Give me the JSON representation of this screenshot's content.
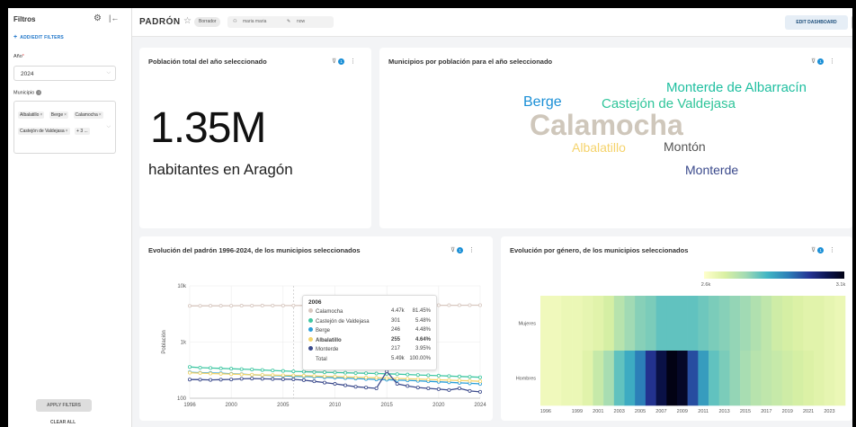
{
  "sidebar": {
    "title": "Filtros",
    "gear_icon": "gear-icon",
    "collapse_icon": "collapse-left-icon",
    "add_filters": "ADD/EDIT FILTERS",
    "year_label": "Año",
    "year_value": "2024",
    "municipio_label": "Municipio",
    "municipio_tags": [
      "Albalatillo",
      "Berge",
      "Calamocha",
      "Castejón de Valdejasa"
    ],
    "municipio_more": "+ 3 ...",
    "apply_label": "APPLY FILTERS",
    "clear_label": "CLEAR ALL"
  },
  "header": {
    "title": "PADRÓN",
    "badge": "Borrador",
    "owner": "maria maria",
    "modified": "now",
    "edit_label": "EDIT DASHBOARD",
    "more_label": "···"
  },
  "cards": {
    "total": {
      "title": "Población total del año seleccionado",
      "filter_count": "1",
      "value": "1.35M",
      "subtitle": "habitantes en Aragón"
    },
    "wordcloud": {
      "title": "Municipios por población para el año seleccionado",
      "filter_count": "1",
      "words": [
        {
          "text": "Monterde de Albarracín",
          "color": "#1fbfa0"
        },
        {
          "text": "Berge",
          "color": "#1a8fd6"
        },
        {
          "text": "Castejón de Valdejasa",
          "color": "#2fc59a"
        },
        {
          "text": "Calamocha",
          "color": "#cfc7bb"
        },
        {
          "text": "Albalatillo",
          "color": "#f5d36b"
        },
        {
          "text": "Montón",
          "color": "#555555"
        },
        {
          "text": "Monterde",
          "color": "#3b4a8c"
        }
      ]
    },
    "evolucion": {
      "title": "Evolución del padrón 1996-2024, de los municipios seleccionados",
      "filter_count": "1",
      "tooltip": {
        "year": "2006",
        "rows": [
          {
            "name": "Calamocha",
            "value": "4.47k",
            "pct": "81.45%",
            "color": "#d8c8c0",
            "bold": false
          },
          {
            "name": "Castejón de Valdejasa",
            "value": "301",
            "pct": "5.48%",
            "color": "#3fc7a2",
            "bold": false
          },
          {
            "name": "Berge",
            "value": "246",
            "pct": "4.48%",
            "color": "#2a9ed8",
            "bold": false
          },
          {
            "name": "Albalatillo",
            "value": "255",
            "pct": "4.64%",
            "color": "#f3d46a",
            "bold": true
          },
          {
            "name": "Monterde",
            "value": "217",
            "pct": "3.95%",
            "color": "#3b4a8c",
            "bold": false
          },
          {
            "name": "Total",
            "value": "5.49k",
            "pct": "100.00%",
            "color": "",
            "bold": false
          }
        ]
      }
    },
    "genero": {
      "title": "Evolución por género, de los municipios seleccionados",
      "filter_count": "1",
      "scale_min": "2.6k",
      "scale_max": "3.1k"
    }
  },
  "colors": {
    "accent": "#1a73c8",
    "filter_badge": "#1a8fd6"
  },
  "chart_data": [
    {
      "type": "line",
      "title": "Evolución del padrón 1996-2024, de los municipios seleccionados",
      "ylabel": "Población",
      "yscale": "log",
      "ylim": [
        100,
        10000
      ],
      "yticks": [
        "10k",
        "1k",
        "100"
      ],
      "x": [
        1996,
        1997,
        1998,
        1999,
        2000,
        2001,
        2002,
        2003,
        2004,
        2005,
        2006,
        2007,
        2008,
        2009,
        2010,
        2011,
        2012,
        2013,
        2014,
        2015,
        2016,
        2017,
        2018,
        2019,
        2020,
        2021,
        2022,
        2023,
        2024
      ],
      "xticks": [
        1996,
        2000,
        2005,
        2010,
        2015,
        2020,
        2024
      ],
      "series": [
        {
          "name": "Calamocha",
          "color": "#d8c8c0",
          "values": [
            4400,
            4410,
            4420,
            4420,
            4430,
            4440,
            4450,
            4460,
            4470,
            4470,
            4470,
            4480,
            4480,
            4490,
            4500,
            4500,
            4510,
            4510,
            4510,
            4500,
            4500,
            4500,
            4510,
            4510,
            4520,
            4520,
            4520,
            4530,
            4530
          ]
        },
        {
          "name": "Castejón de Valdejasa",
          "color": "#3fc7a2",
          "values": [
            360,
            350,
            345,
            340,
            335,
            330,
            325,
            318,
            312,
            306,
            301,
            297,
            293,
            290,
            287,
            284,
            281,
            278,
            275,
            272,
            268,
            264,
            260,
            256,
            252,
            248,
            244,
            240,
            236
          ]
        },
        {
          "name": "Berge",
          "color": "#2a9ed8",
          "values": [
            290,
            285,
            282,
            278,
            272,
            268,
            262,
            258,
            254,
            250,
            246,
            244,
            240,
            236,
            232,
            228,
            224,
            220,
            216,
            214,
            210,
            208,
            204,
            200,
            196,
            192,
            188,
            184,
            180
          ]
        },
        {
          "name": "Albalatillo",
          "color": "#f3d46a",
          "values": [
            285,
            280,
            275,
            272,
            268,
            265,
            262,
            260,
            258,
            256,
            255,
            252,
            249,
            246,
            243,
            240,
            237,
            234,
            231,
            228,
            225,
            222,
            219,
            216,
            213,
            210,
            207,
            204,
            200
          ]
        },
        {
          "name": "Monterde",
          "color": "#3b4a8c",
          "values": [
            215,
            214,
            212,
            214,
            216,
            222,
            224,
            222,
            220,
            218,
            217,
            210,
            200,
            190,
            180,
            170,
            160,
            155,
            150,
            300,
            180,
            165,
            155,
            150,
            145,
            140,
            150,
            135,
            130
          ]
        }
      ]
    },
    {
      "type": "heatmap",
      "title": "Evolución por género, de los municipios seleccionados",
      "categories": [
        "Mujeres",
        "Hombres"
      ],
      "x": [
        1996,
        1997,
        1998,
        1999,
        2000,
        2001,
        2002,
        2003,
        2004,
        2005,
        2006,
        2007,
        2008,
        2009,
        2010,
        2011,
        2012,
        2013,
        2014,
        2015,
        2016,
        2017,
        2018,
        2019,
        2020,
        2021,
        2022,
        2023,
        2024
      ],
      "xticks": [
        1996,
        1999,
        2001,
        2003,
        2005,
        2007,
        2009,
        2011,
        2013,
        2015,
        2017,
        2019,
        2021,
        2023
      ],
      "scale": [
        "2.6k",
        "3.1k"
      ],
      "values": [
        [
          2.63,
          2.63,
          2.64,
          2.64,
          2.65,
          2.66,
          2.68,
          2.72,
          2.75,
          2.77,
          2.78,
          2.8,
          2.8,
          2.8,
          2.8,
          2.79,
          2.78,
          2.77,
          2.76,
          2.75,
          2.73,
          2.71,
          2.69,
          2.68,
          2.67,
          2.66,
          2.66,
          2.65,
          2.64
        ],
        [
          2.63,
          2.63,
          2.64,
          2.64,
          2.66,
          2.7,
          2.74,
          2.8,
          2.84,
          2.9,
          2.98,
          3.05,
          3.1,
          3.08,
          2.95,
          2.86,
          2.8,
          2.78,
          2.76,
          2.74,
          2.72,
          2.71,
          2.7,
          2.69,
          2.68,
          2.67,
          2.66,
          2.65,
          2.64
        ]
      ]
    }
  ]
}
